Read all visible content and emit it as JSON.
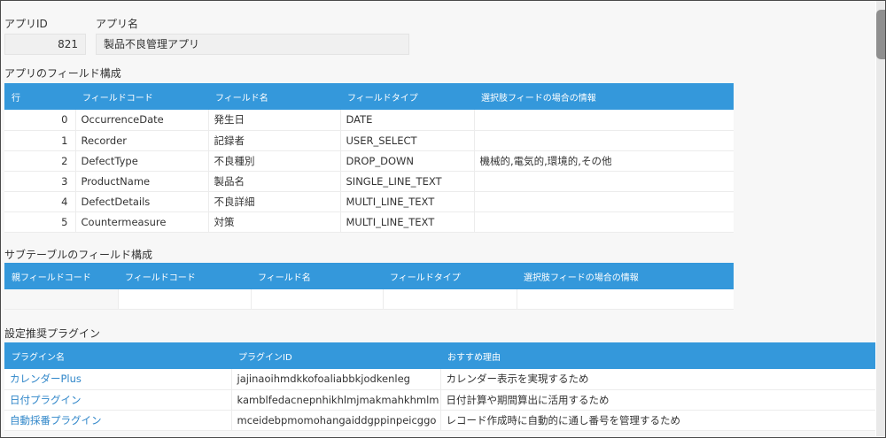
{
  "app": {
    "id_label": "アプリID",
    "id_value": "821",
    "name_label": "アプリ名",
    "name_value": "製品不良管理アプリ"
  },
  "fields_section": {
    "title": "アプリのフィールド構成",
    "headers": [
      "行",
      "フィールドコード",
      "フィールド名",
      "フィールドタイプ",
      "選択肢フィードの場合の情報"
    ],
    "rows": [
      [
        "0",
        "OccurrenceDate",
        "発生日",
        "DATE",
        ""
      ],
      [
        "1",
        "Recorder",
        "記録者",
        "USER_SELECT",
        ""
      ],
      [
        "2",
        "DefectType",
        "不良種別",
        "DROP_DOWN",
        "機械的,電気的,環境的,その他"
      ],
      [
        "3",
        "ProductName",
        "製品名",
        "SINGLE_LINE_TEXT",
        ""
      ],
      [
        "4",
        "DefectDetails",
        "不良詳細",
        "MULTI_LINE_TEXT",
        ""
      ],
      [
        "5",
        "Countermeasure",
        "対策",
        "MULTI_LINE_TEXT",
        ""
      ]
    ]
  },
  "subtable_section": {
    "title": "サブテーブルのフィールド構成",
    "headers": [
      "親フィールドコード",
      "フィールドコード",
      "フィールド名",
      "フィールドタイプ",
      "選択肢フィードの場合の情報"
    ]
  },
  "plugins_section": {
    "title": "設定推奨プラグイン",
    "headers": [
      "プラグイン名",
      "プラグインID",
      "おすすめ理由"
    ],
    "rows": [
      [
        "カレンダーPlus",
        "jajinaoihmdkkofoaliabbkjodkenleg",
        "カレンダー表示を実現するため"
      ],
      [
        "日付プラグイン",
        "kamblfedacnepnhikhlmjmakmahkhmlm",
        "日付計算や期間算出に活用するため"
      ],
      [
        "自動採番プラグイン",
        "mceidebpmomohangaiddgppinpeicggo",
        "レコード作成時に自動的に通し番号を管理するため"
      ]
    ]
  },
  "colors": {
    "header_blue": "#3498db",
    "link_blue": "#2f86c9"
  }
}
